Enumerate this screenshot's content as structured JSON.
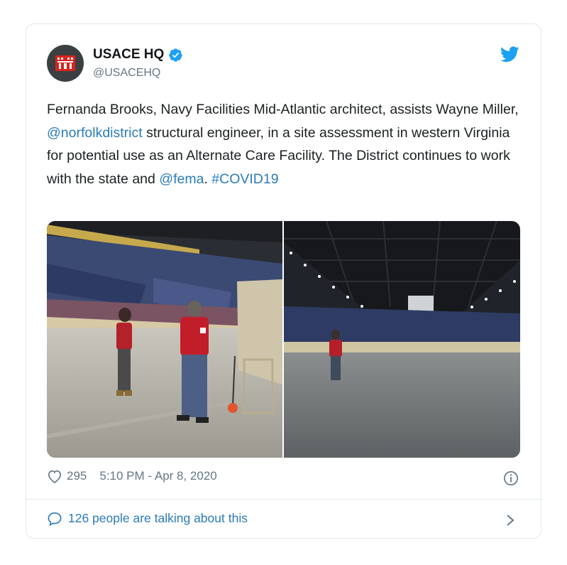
{
  "tweet": {
    "author_name": "USACE HQ",
    "handle": "@USACEHQ",
    "text_parts": [
      {
        "t": "Fernanda Brooks, Navy Facilities Mid-Atlantic architect, assists Wayne Miller, ",
        "link": false
      },
      {
        "t": "@norfolkdistrict",
        "link": true
      },
      {
        "t": " structural engineer, in a site assessment in western Virginia for potential use as an Alternate Care Facility. The District continues to work with the state and ",
        "link": false
      },
      {
        "t": "@fema",
        "link": true
      },
      {
        "t": ". ",
        "link": false
      },
      {
        "t": "#COVID19",
        "link": true
      }
    ],
    "likes": "295",
    "timestamp": "5:10 PM - Apr 8, 2020",
    "conversation": "126 people are talking about this"
  },
  "icons": {
    "avatar": "usace-castle-logo",
    "verified": "verified-badge-icon",
    "platform": "twitter-bird-icon",
    "like": "heart-icon",
    "info": "info-icon",
    "reply": "speech-bubble-icon",
    "more": "chevron-right-icon"
  },
  "colors": {
    "link": "#2b7bb9",
    "verified": "#1da1f2",
    "twitter_blue": "#1da1f2",
    "muted": "#657786",
    "logo_red": "#d6241e"
  }
}
